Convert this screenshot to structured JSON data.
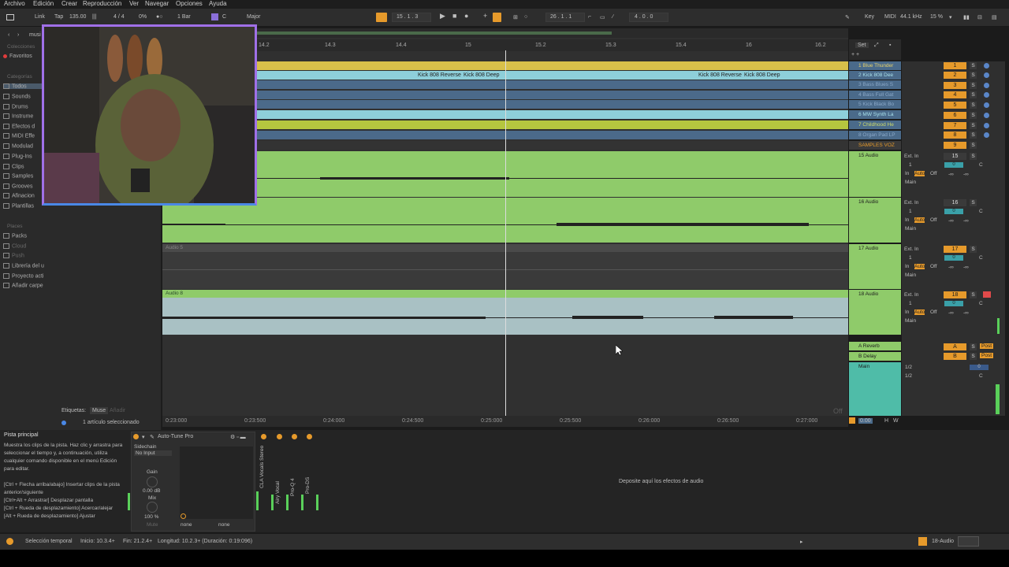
{
  "menu": [
    "Archivo",
    "Edición",
    "Crear",
    "Reproducción",
    "Ver",
    "Navegar",
    "Opciones",
    "Ayuda"
  ],
  "control": {
    "link": "Link",
    "tap": "Tap",
    "tempo": "135.00",
    "meter": "4 / 4",
    "cpu_pct": "0%",
    "quantize": "1 Bar",
    "key": "C",
    "scale": "Major",
    "position": "15 .  1 .  3",
    "loop_start": "26 .  1 .  1",
    "loop_len": "4 .  0 .  0",
    "key_label": "Key",
    "midi_label": "MIDI",
    "sample_rate": "44.1 kHz",
    "zoom_pct": "15 %"
  },
  "browser": {
    "search_crumb": "musi",
    "collections_heading": "Colecciones",
    "favorites": "Favoritos",
    "categories_heading": "Categorías",
    "categories": [
      "Todos",
      "Sounds",
      "Drums",
      "Instrume",
      "Efectos d",
      "MIDI Effe",
      "Modulad",
      "Plug-Ins",
      "Clips",
      "Samples",
      "Grooves",
      "Afinacion",
      "Plantillas"
    ],
    "places_heading": "Places",
    "places": [
      "Packs",
      "Cloud",
      "Push",
      "Librería del u",
      "Proyecto acti",
      "Añadir carpe"
    ],
    "tags_label": "Etiquetas:",
    "tag_value": "Muse",
    "tag_add": "Añadir",
    "selected_count": "1 artículo seleccionado"
  },
  "ruler": [
    "14.2",
    "14.3",
    "14.4",
    "15",
    "15.2",
    "15.3",
    "15.4",
    "16",
    "16.2"
  ],
  "set_label": "Set",
  "clips": {
    "kick_reverse": "Kick 808 Reverse",
    "kick_deep": "Kick 808 Deep",
    "audio5": "Audio 5",
    "audio8": "Audio 8"
  },
  "small_tracks": [
    {
      "name": "1 Blue Thunder",
      "num": "1",
      "color": "#d8c04a"
    },
    {
      "name": "2 Kick 808 Dee",
      "num": "2",
      "color": "#8ecfda"
    },
    {
      "name": "3 Bass Blues S",
      "num": "3",
      "color": "#4b6a8a"
    },
    {
      "name": "4 Bass Full Gat",
      "num": "4",
      "color": "#4b6a8a"
    },
    {
      "name": "5 Kick Black Bo",
      "num": "5",
      "color": "#4b6a8a"
    },
    {
      "name": "6 MW Synth La",
      "num": "6",
      "color": "#8ecfda"
    },
    {
      "name": "7 Childhood He",
      "num": "7",
      "color": "#b5c63f"
    },
    {
      "name": "8 Organ Pad LP",
      "num": "8",
      "color": "#4b6a8a"
    }
  ],
  "group_track": {
    "name": "SAMPLES VOZ",
    "num": "9"
  },
  "audio_tracks": [
    {
      "name": "15 Audio",
      "num": "15",
      "input": "Ext. In",
      "ch": "1",
      "vol": "0",
      "pan": "C",
      "send": "-∞"
    },
    {
      "name": "16 Audio",
      "num": "16",
      "input": "Ext. In",
      "ch": "1",
      "vol": "0",
      "pan": "C",
      "send": "-∞"
    },
    {
      "name": "17 Audio",
      "num": "17",
      "input": "Ext. In",
      "ch": "1",
      "vol": "0",
      "pan": "C",
      "send": "-∞"
    },
    {
      "name": "18 Audio",
      "num": "18",
      "input": "Ext. In",
      "ch": "1",
      "vol": "0",
      "pan": "C",
      "send": "-∞"
    }
  ],
  "monitor": {
    "in": "In",
    "auto": "Auto",
    "off": "Off",
    "out": "Main"
  },
  "returns": [
    {
      "name": "A Reverb",
      "letter": "A",
      "post": "Post"
    },
    {
      "name": "B Delay",
      "letter": "B",
      "post": "Post"
    }
  ],
  "main_track": {
    "name": "Main",
    "out1": "1/2",
    "out2": "1/2",
    "vol": "0",
    "pan": "C"
  },
  "off_label": "Off",
  "timebar": [
    "0:23:000",
    "0:23:500",
    "0:24:000",
    "0:24:500",
    "0:25:000",
    "0:25:500",
    "0:26:000",
    "0:26:500",
    "0:27:000"
  ],
  "timebar_zoom": "0.00",
  "h_label": "H",
  "w_label": "W",
  "info": {
    "title": "Pista principal",
    "body1": "Muestra los clips de la pista. Haz clic y arrastra para seleccionar el tiempo y, a continuación, utiliza cualquier comando disponible en el menú Edición para editar.",
    "body2": "[Ctrl + Flecha arriba/abajo] Insertar clips de la pista anterior/siguiente",
    "body3": "[Ctrl+Alt + Arrastrar] Desplazar pantalla",
    "body4": "[Ctrl + Rueda de desplazamiento] Acercar/alejar",
    "body5": "[Alt + Rueda de desplazamiento] Ajustar"
  },
  "device": {
    "name": "Auto-Tune Pro",
    "sidechain": "Sidechain",
    "input": "No Input",
    "gain": "Gain",
    "gain_val": "0.00 dB",
    "mix": "Mix",
    "mix_val": "100 %",
    "mute": "Mute",
    "none1": "none",
    "none2": "none",
    "chain": [
      "CLA Vocals Stereo",
      "Airy Vocal",
      "Pro-Q 4",
      "Pro-DS"
    ]
  },
  "drop_hint": "Deposite aquí los efectos de audio",
  "status": {
    "left": "Selección temporal",
    "start": "Inicio: 10.3.4+",
    "end": "Fin: 21.2.4+",
    "length": "Longitud: 10.2.3+ (Duración: 0:19:096)",
    "track": "18-Audio"
  },
  "colors": {
    "yellow": "#d8c04a",
    "lightblue": "#8ecfda",
    "slate": "#4b6a8a",
    "green": "#8fcb6a",
    "lime": "#b5c63f",
    "teal": "#4fbca8",
    "orange": "#e69a2b"
  }
}
